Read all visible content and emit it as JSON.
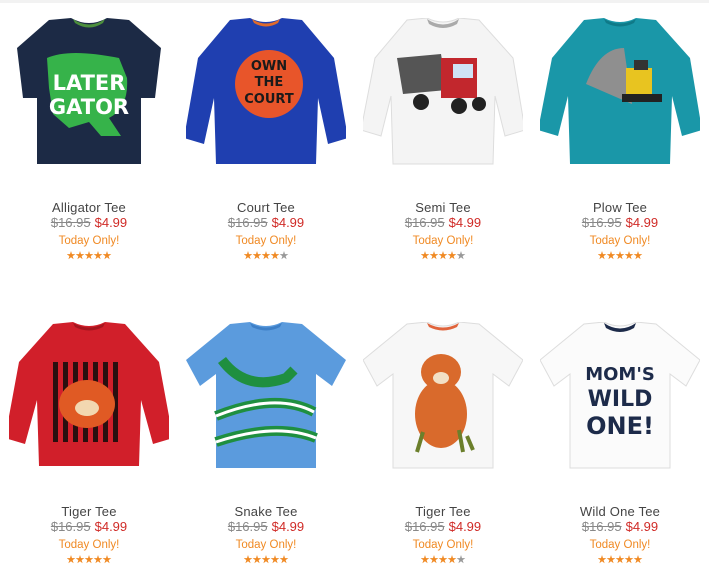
{
  "products": [
    {
      "name": "Alligator Tee",
      "orig_price": "$16.95",
      "sale_price": "$4.99",
      "promo": "Today Only!",
      "rating": 5,
      "color": "#1c2a45",
      "art_text": [
        "LATER",
        "GATOR"
      ],
      "icon": "alligator-tee-icon"
    },
    {
      "name": "Court Tee",
      "orig_price": "$16.95",
      "sale_price": "$4.99",
      "promo": "Today Only!",
      "rating": 4,
      "color": "#1f3fb0",
      "art_text": [
        "OWN",
        "THE",
        "COURT"
      ],
      "icon": "basketball-tee-icon"
    },
    {
      "name": "Semi Tee",
      "orig_price": "$16.95",
      "sale_price": "$4.99",
      "promo": "Today Only!",
      "rating": 4.5,
      "color": "#f4f4f4",
      "art_text": [],
      "icon": "truck-tee-icon"
    },
    {
      "name": "Plow Tee",
      "orig_price": "$16.95",
      "sale_price": "$4.99",
      "promo": "Today Only!",
      "rating": 5,
      "color": "#1a97a8",
      "art_text": [],
      "icon": "plow-tee-icon"
    },
    {
      "name": "Tiger Tee",
      "orig_price": "$16.95",
      "sale_price": "$4.99",
      "promo": "Today Only!",
      "rating": 5,
      "color": "#d11f2a",
      "art_text": [],
      "icon": "tiger-tee-icon"
    },
    {
      "name": "Snake Tee",
      "orig_price": "$16.95",
      "sale_price": "$4.99",
      "promo": "Today Only!",
      "rating": 5,
      "color": "#5b9bdd",
      "art_text": [],
      "icon": "snake-tee-icon"
    },
    {
      "name": "Tiger Tee",
      "orig_price": "$16.95",
      "sale_price": "$4.99",
      "promo": "Today Only!",
      "rating": 4.5,
      "color": "#f7f7f7",
      "art_text": [],
      "icon": "tiger-cub-tee-icon"
    },
    {
      "name": "Wild One Tee",
      "orig_price": "$16.95",
      "sale_price": "$4.99",
      "promo": "Today Only!",
      "rating": 5,
      "color": "#fbfbfb",
      "art_text": [
        "MOM'S",
        "WILD",
        "ONE!"
      ],
      "icon": "wild-one-tee-icon"
    }
  ]
}
